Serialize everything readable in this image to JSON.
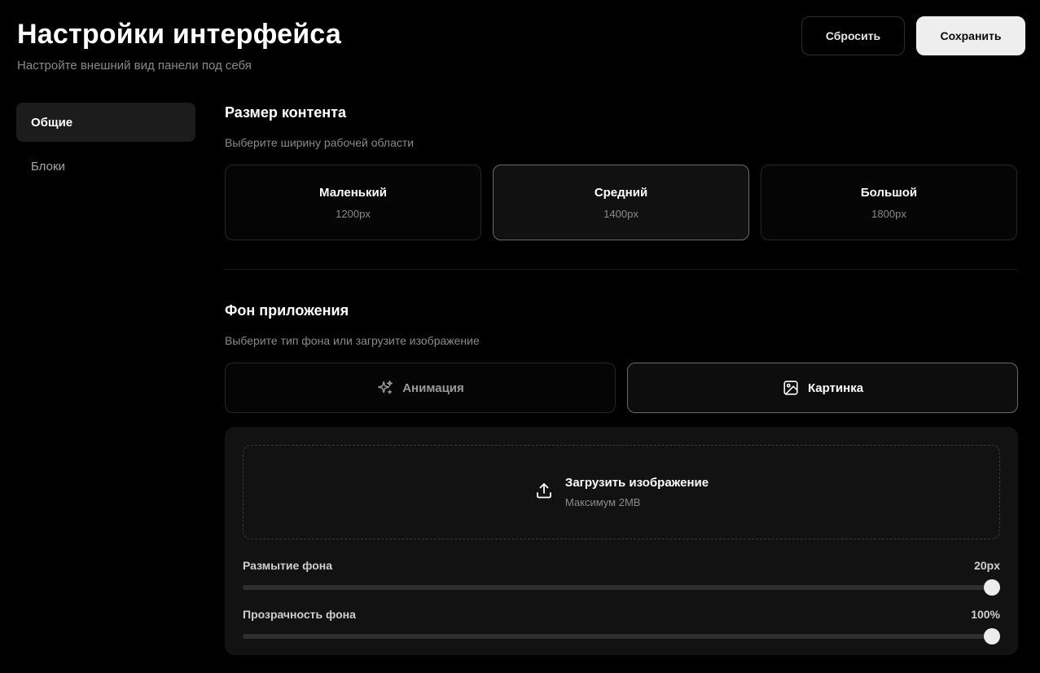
{
  "header": {
    "title": "Настройки интерфейса",
    "subtitle": "Настройте внешний вид панели под себя",
    "reset_label": "Сбросить",
    "save_label": "Сохранить"
  },
  "sidebar": {
    "items": [
      {
        "label": "Общие",
        "active": true
      },
      {
        "label": "Блоки",
        "active": false
      }
    ]
  },
  "content_size": {
    "title": "Размер контента",
    "description": "Выберите ширину рабочей области",
    "options": [
      {
        "name": "Маленький",
        "value": "1200px",
        "selected": false
      },
      {
        "name": "Средний",
        "value": "1400px",
        "selected": true
      },
      {
        "name": "Большой",
        "value": "1800px",
        "selected": false
      }
    ]
  },
  "app_background": {
    "title": "Фон приложения",
    "description": "Выберите тип фона или загрузите изображение",
    "options": [
      {
        "label": "Анимация",
        "icon": "sparkles-icon",
        "selected": false
      },
      {
        "label": "Картинка",
        "icon": "image-icon",
        "selected": true
      }
    ],
    "upload": {
      "title": "Загрузить изображение",
      "hint": "Максимум 2MB",
      "icon": "upload-icon"
    },
    "blur": {
      "label": "Размытие фона",
      "value_text": "20px",
      "level": 1.0
    },
    "opacity": {
      "label": "Прозрачность фона",
      "value_text": "100%",
      "level": 1.0
    }
  }
}
